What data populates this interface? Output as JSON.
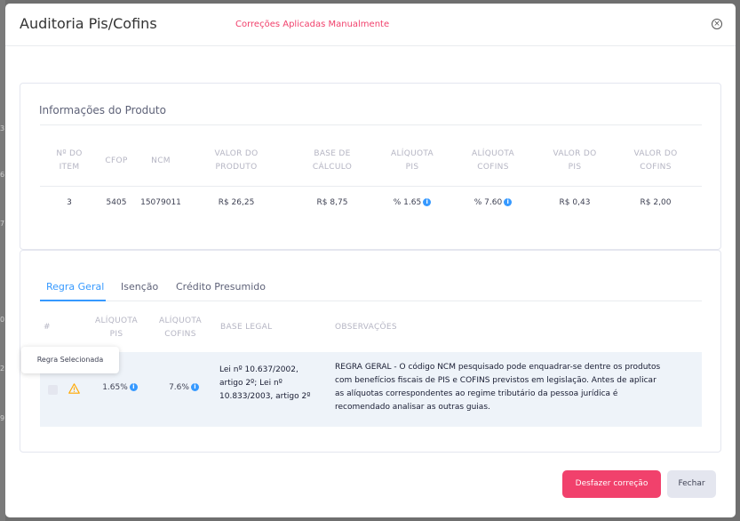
{
  "modal": {
    "title": "Auditoria Pis/Cofins",
    "subtitle": "Correções Aplicadas Manualmente",
    "close_icon": "×"
  },
  "background_fragments": [
    "3",
    "6",
    "7",
    "0",
    "2",
    "9"
  ],
  "product": {
    "section_title": "Informações do Produto",
    "columns": [
      [
        "Nº DO",
        "ITEM"
      ],
      [
        "CFOP",
        ""
      ],
      [
        "NCM",
        ""
      ],
      [
        "VALOR DO",
        "PRODUTO"
      ],
      [
        "BASE DE",
        "CÁLCULO"
      ],
      [
        "ALÍQUOTA",
        "PIS"
      ],
      [
        "ALÍQUOTA",
        "COFINS"
      ],
      [
        "VALOR DO",
        "PIS"
      ],
      [
        "VALOR DO",
        "COFINS"
      ]
    ],
    "row": {
      "item": "3",
      "cfop": "5405",
      "ncm": "15079011",
      "valor_produto": "R$ 26,25",
      "base_calculo": "R$ 8,75",
      "aliquota_pis": "% 1.65",
      "aliquota_cofins": "% 7.60",
      "valor_pis": "R$ 0,43",
      "valor_cofins": "R$ 2,00"
    }
  },
  "rules": {
    "tabs": [
      "Regra Geral",
      "Isenção",
      "Crédito Presumido"
    ],
    "active_tab": "Regra Geral",
    "columns": {
      "hash": "#",
      "aliquota_pis": [
        "ALÍQUOTA",
        "PIS"
      ],
      "aliquota_cofins": [
        "ALÍQUOTA",
        "COFINS"
      ],
      "base_legal": "BASE LEGAL",
      "observacoes": "OBSERVAÇÕES"
    },
    "row": {
      "aliquota_pis": "1.65%",
      "aliquota_cofins": "7.6%",
      "base_legal": [
        "Lei nº 10.637/2002,",
        "artigo 2º; Lei nº",
        "10.833/2003, artigo 2º"
      ],
      "observacoes": [
        "REGRA GERAL - O código NCM pesquisado pode enquadrar-se dentre os produtos",
        "com benefícios fiscais de PIS e COFINS previstos em legislação. Antes de aplicar",
        "as alíquotas correspondentes ao regime tributário da pessoa jurídica é",
        "recomendado analisar as outras guias."
      ]
    },
    "tooltip": "Regra Selecionada"
  },
  "footer": {
    "undo_label": "Desfazer correção",
    "close_label": "Fechar"
  },
  "colors": {
    "accent": "#3699ff",
    "danger": "#f1416c",
    "warning": "#ffa800"
  }
}
